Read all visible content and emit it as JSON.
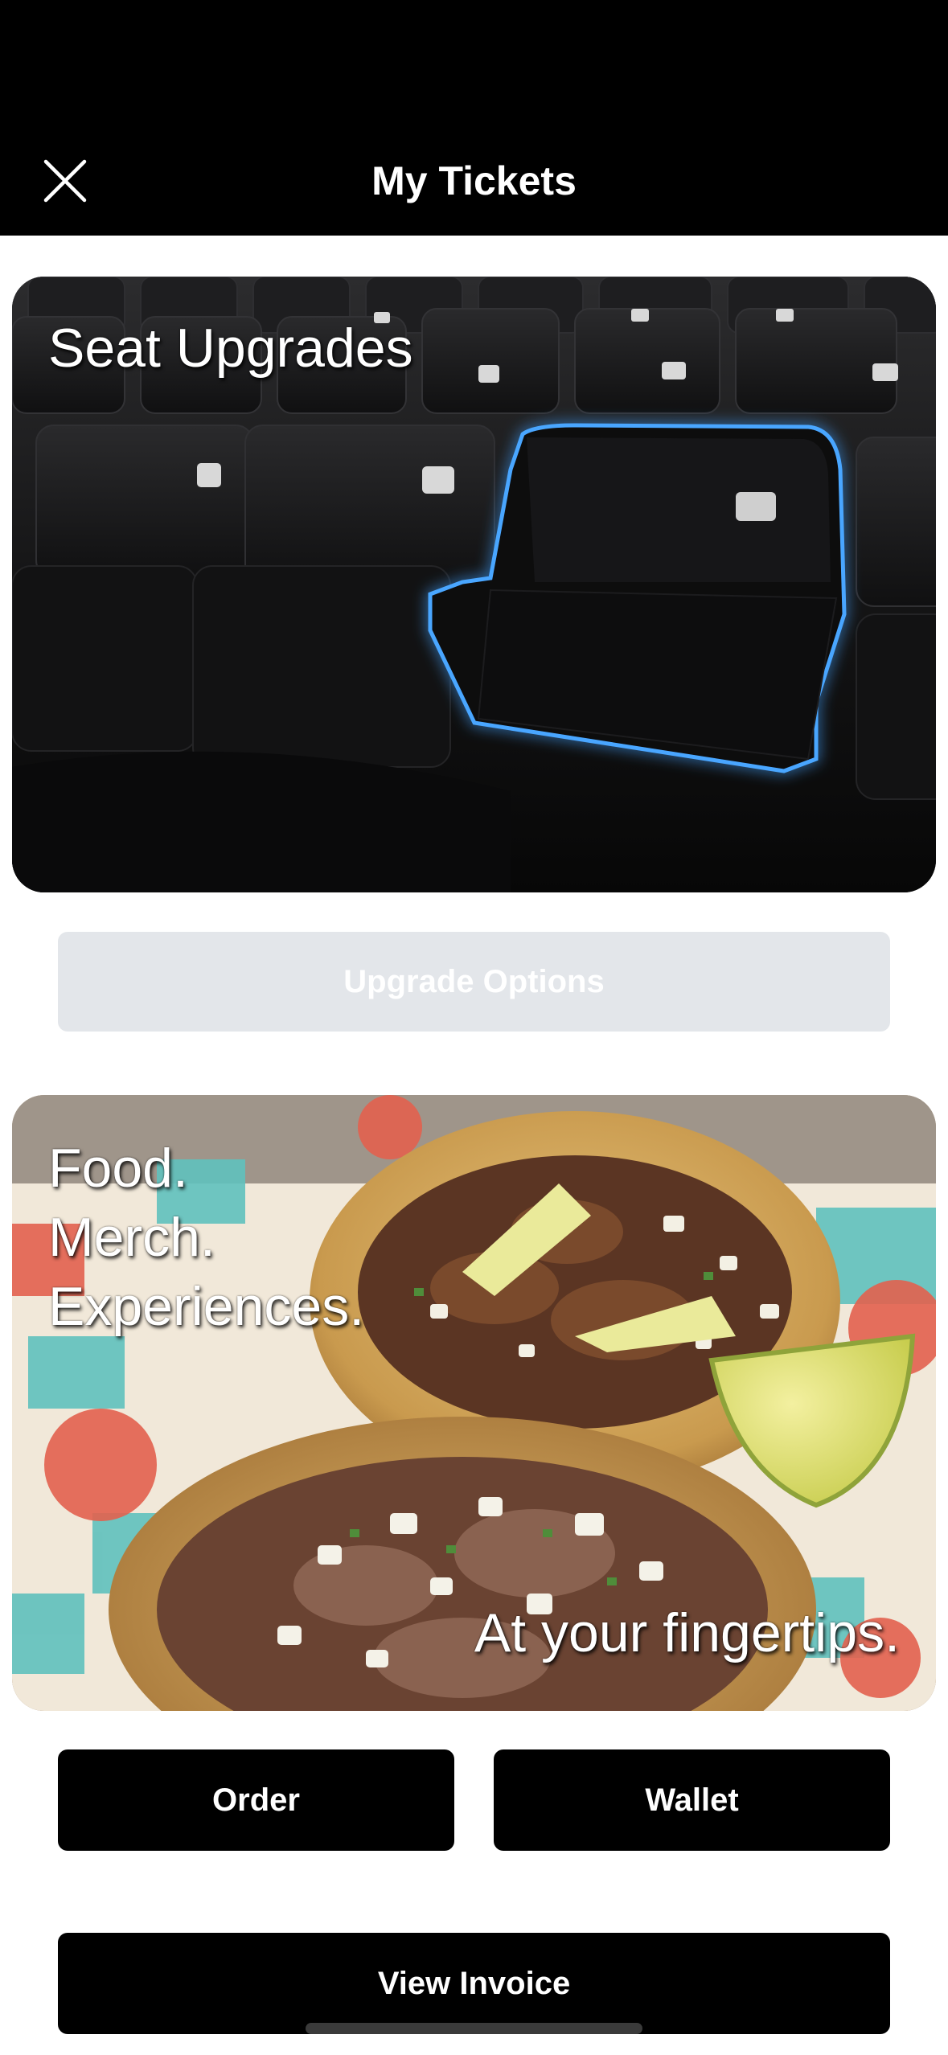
{
  "header": {
    "title": "My Tickets",
    "close_icon": "close-icon"
  },
  "seat_card": {
    "title": "Seat Upgrades",
    "image": "stadium-seats-highlighted-photo",
    "highlight_color": "#2f8dff"
  },
  "upgrade_button": {
    "label": "Upgrade Options",
    "state": "disabled"
  },
  "food_card": {
    "lines": [
      "Food.",
      "Merch.",
      "Experiences."
    ],
    "tagline": "At your fingertips.",
    "image": "tacos-photo"
  },
  "buttons": {
    "order": "Order",
    "wallet": "Wallet",
    "invoice": "View Invoice"
  },
  "colors": {
    "header_bg": "#000000",
    "button_bg": "#000000",
    "disabled_button_bg": "#e3e6ea"
  }
}
